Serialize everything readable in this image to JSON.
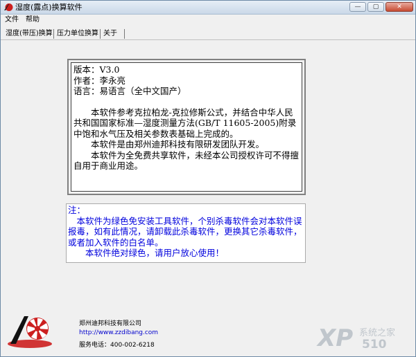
{
  "window": {
    "title": "湿度(露点)换算软件"
  },
  "menu": [
    "文件",
    "帮助"
  ],
  "tabs": [
    "湿度(带压)换算",
    "压力单位换算",
    "关于"
  ],
  "about": {
    "lines": [
      "版本：V3.0",
      "作者：李永亮",
      "语言：易语言（全中文国产）",
      "",
      "　　本软件参考克拉柏龙-克拉修斯公式，并结合中华人民共和国国家标准—湿度测量方法(GB/T 11605-2005)附录中饱和水气压及相关参数表基础上完成的。",
      "　　本软件是由郑州迪邦科技有限研发团队开发。",
      "　　本软件为全免费共享软件，未经本公司授权许可不得擅自用于商业用途。"
    ]
  },
  "note": {
    "lines": [
      "注：",
      "　本软件为绿色免安装工具软件，个别杀毒软件会对本软件误报毒，如有此情况，请卸载此杀毒软件，更换其它杀毒软件，或者加入软件的白名单。",
      "　　本软件绝对绿色，请用户放心使用！"
    ]
  },
  "footer": {
    "company": "郑州迪邦科技有限公司",
    "url": "http://www.zzdibang.com",
    "phone": "服务电话：400-002-6218"
  },
  "watermark": {
    "text": "XP",
    "sub": "系统之家",
    "num": "510"
  },
  "colors": {
    "note_text": "#0000dd",
    "logo_red": "#cc1f1f"
  }
}
